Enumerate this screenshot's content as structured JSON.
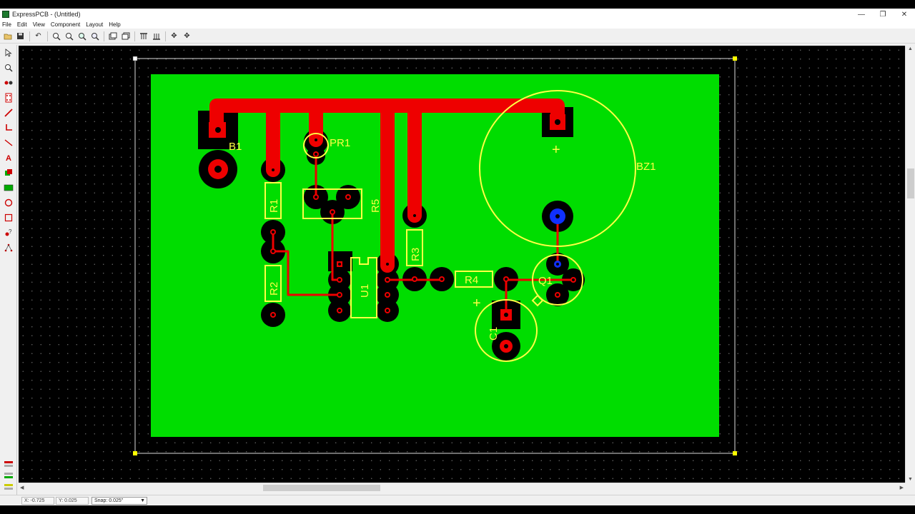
{
  "window": {
    "title": "ExpressPCB - (Untitled)"
  },
  "menu": [
    "File",
    "Edit",
    "View",
    "Component",
    "Layout",
    "Help"
  ],
  "toolbar": {
    "icons": [
      "open-icon",
      "save-icon",
      "undo-icon",
      "zoom-in-icon",
      "zoom-out-icon",
      "zoom-window-icon",
      "zoom-fit-icon",
      "layer-top-icon",
      "layer-bottom-icon",
      "pad-top-icon",
      "pad-bottom-icon",
      "move-icon",
      "center-icon"
    ]
  },
  "palette": {
    "tools": [
      "pointer-tool-icon",
      "zoom-tool-icon",
      "pad-tool-icon",
      "component-tool-icon",
      "trace-tool-icon",
      "corner-tool-icon",
      "line-tool-icon",
      "text-tool-icon",
      "fill-tool-icon",
      "copper-pour-tool-icon",
      "circle-tool-icon",
      "rectangle-tool-icon",
      "pin-tool-icon",
      "net-tool-icon"
    ]
  },
  "board": {
    "labels": {
      "b1": "B1",
      "pr1": "PR1",
      "r5": "R5",
      "r1": "R1",
      "r2": "R2",
      "u1": "U1",
      "r3": "R3",
      "r4": "R4",
      "q1": "Q1",
      "c1": "C1",
      "bz1": "BZ1",
      "plus_bz1": "+",
      "plus_c1": "+"
    },
    "colors": {
      "substrate": "#00dd00",
      "trace": "#ee0000",
      "silkscreen": "#ffff44",
      "pad": "#000000",
      "via_blue": "#1030ff"
    }
  },
  "status": {
    "x": "X: -0.725",
    "y": "Y: 0.025",
    "snap": "Snap: 0.025\""
  }
}
